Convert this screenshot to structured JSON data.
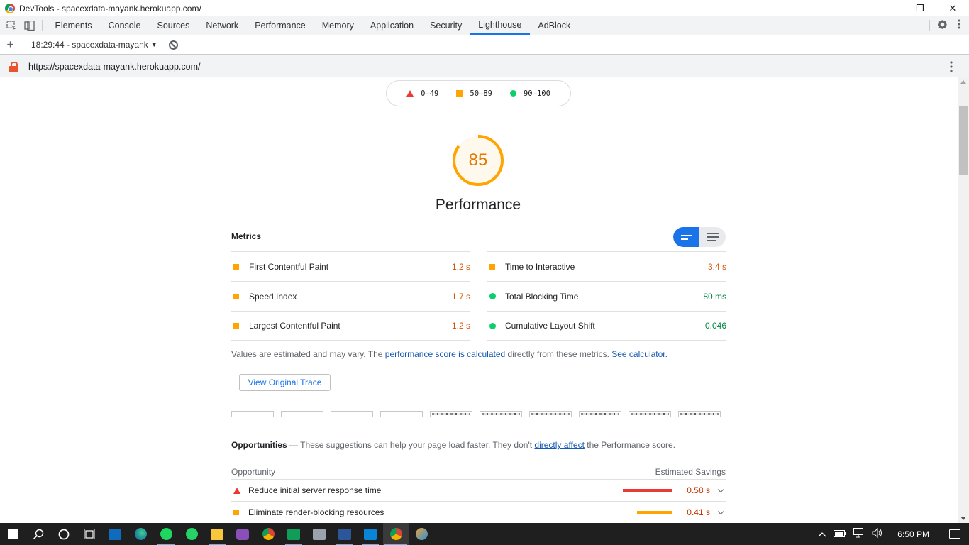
{
  "window": {
    "title": "DevTools - spacexdata-mayank.herokuapp.com/",
    "minimize": "—",
    "restore": "❐",
    "close": "✕"
  },
  "devtools_tabs": [
    {
      "label": "Elements",
      "active": false
    },
    {
      "label": "Console",
      "active": false
    },
    {
      "label": "Sources",
      "active": false
    },
    {
      "label": "Network",
      "active": false
    },
    {
      "label": "Performance",
      "active": false
    },
    {
      "label": "Memory",
      "active": false
    },
    {
      "label": "Application",
      "active": false
    },
    {
      "label": "Security",
      "active": false
    },
    {
      "label": "Lighthouse",
      "active": true
    },
    {
      "label": "AdBlock",
      "active": false
    }
  ],
  "lighthouse_toolbar": {
    "report_label": "18:29:44 - spacexdata-mayank",
    "dropdown_arrow": "▼"
  },
  "urlbar": {
    "url": "https://spacexdata-mayank.herokuapp.com/"
  },
  "legend": {
    "fail": "0–49",
    "average": "50–89",
    "pass": "90–100"
  },
  "gauge": {
    "score": "85",
    "score_fraction": 0.85,
    "title": "Performance",
    "color": "#ffa400"
  },
  "metrics": {
    "heading": "Metrics",
    "left": [
      {
        "label": "First Contentful Paint",
        "value": "1.2 s",
        "rating": "average"
      },
      {
        "label": "Speed Index",
        "value": "1.7 s",
        "rating": "average"
      },
      {
        "label": "Largest Contentful Paint",
        "value": "1.2 s",
        "rating": "average"
      }
    ],
    "right": [
      {
        "label": "Time to Interactive",
        "value": "3.4 s",
        "rating": "average"
      },
      {
        "label": "Total Blocking Time",
        "value": "80 ms",
        "rating": "pass"
      },
      {
        "label": "Cumulative Layout Shift",
        "value": "0.046",
        "rating": "pass"
      }
    ]
  },
  "note": {
    "prefix": "Values are estimated and may vary. The ",
    "link1": "performance score is calculated",
    "middle": " directly from these metrics. ",
    "link2": "See calculator."
  },
  "trace_button": "View Original Trace",
  "opportunities": {
    "heading": "Opportunities",
    "description_prefix": " — These suggestions can help your page load faster. They don't ",
    "description_link": "directly affect",
    "description_suffix": " the Performance score.",
    "col_opportunity": "Opportunity",
    "col_savings": "Estimated Savings",
    "rows": [
      {
        "title": "Reduce initial server response time",
        "savings": "0.58 s",
        "rating": "fail",
        "bar_color": "#eb3a32",
        "bar_fraction": 1.0
      },
      {
        "title": "Eliminate render-blocking resources",
        "savings": "0.41 s",
        "rating": "average",
        "bar_color": "#ffa400",
        "bar_fraction": 0.71
      }
    ]
  },
  "taskbar": {
    "time": "6:50 PM",
    "apps": [
      "start-icon",
      "search-icon",
      "cortana-icon",
      "task-view-icon",
      "mail-icon",
      "edge-icon",
      "spotify-icon",
      "whatsapp-icon",
      "file-explorer-icon",
      "gitkraken-icon",
      "chrome-icon",
      "hangouts-icon",
      "photos-icon",
      "word-icon",
      "vscode-icon",
      "chrome-dev-icon",
      "paint-icon"
    ]
  },
  "colors": {
    "accent": "#1a73e8",
    "fail": "#eb3a32",
    "average": "#ffa400",
    "pass": "#0cce6b"
  }
}
